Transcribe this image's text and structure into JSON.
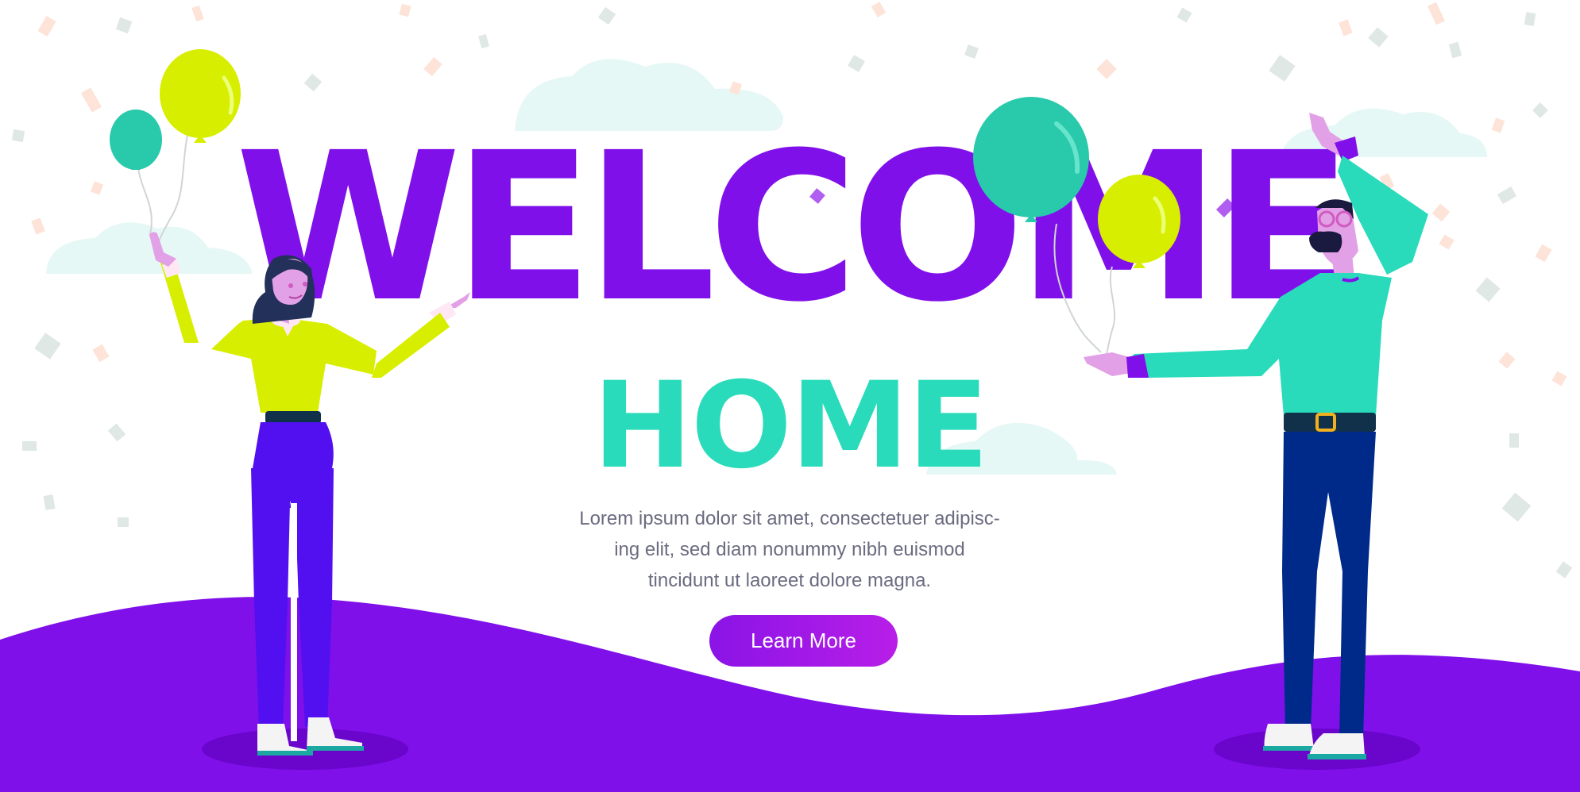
{
  "hero": {
    "title_line1": "WELCOME",
    "title_line2": "HOME",
    "body_lines": [
      "Lorem ipsum dolor sit amet, consectetuer adipisc-",
      "ing elit, sed diam nonummy nibh euismod",
      "tincidunt ut laoreet dolore magna."
    ],
    "cta_label": "Learn More"
  },
  "colors": {
    "purple": "#8010ea",
    "teal": "#29dbba",
    "lime": "#d8ee00",
    "indigo": "#5210f0",
    "navy": "#002a8a",
    "pink": "#e2a0e6",
    "text": "#6b6b80"
  }
}
